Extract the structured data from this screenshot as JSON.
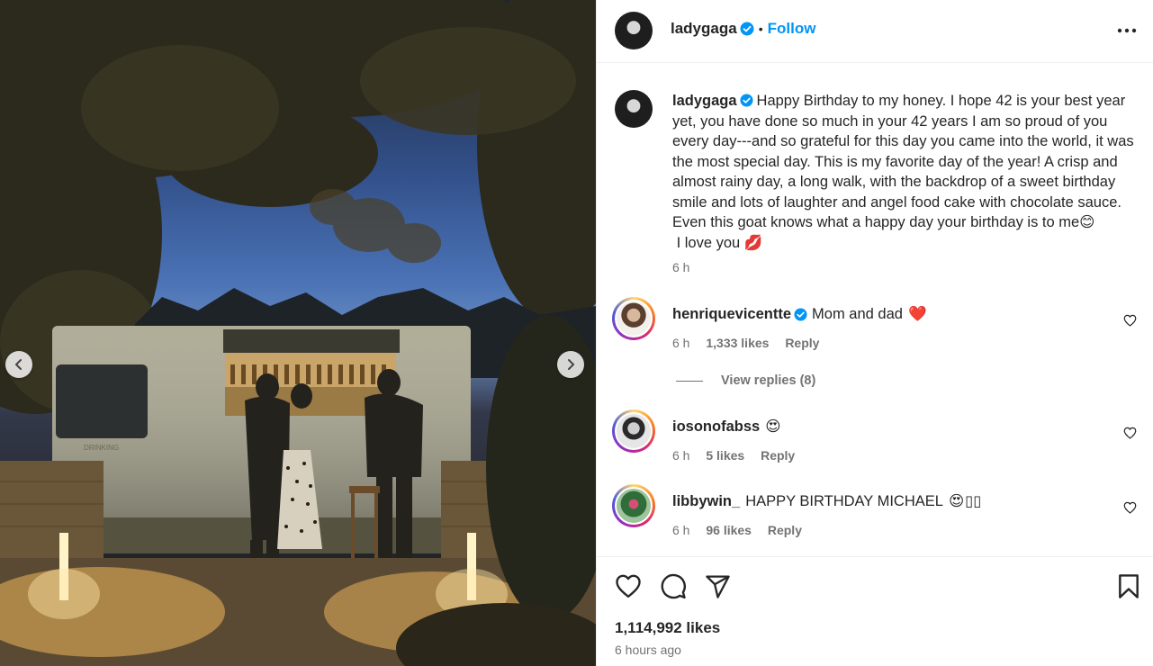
{
  "post": {
    "author": "ladygaga",
    "follow_label": "Follow",
    "separator": "•",
    "caption": "Happy Birthday to my honey. I hope 42 is your best year yet, you have done so much in your 42 years I am so proud of you every day---and so grateful for this day you came into the world, it was the most special day. This is my favorite day of the year! A crisp and almost rainy day, a long walk, with the backdrop of a sweet birthday smile and lots of laughter and angel food cake with chocolate sauce. Even this goat knows what a happy day your birthday is to me",
    "caption_emoji_1": "😊",
    "caption_tail": " I love you ",
    "caption_emoji_2": "💋",
    "caption_time": "6 h",
    "likes": "1,114,992 likes",
    "time_ago": "6 hours ago"
  },
  "photo": {
    "truck_sign": "DRINKING"
  },
  "comments": [
    {
      "username": "henriquevicentte",
      "verified": true,
      "text": "Mom and dad",
      "emoji": "❤️",
      "time": "6 h",
      "likes": "1,333 likes",
      "reply_label": "Reply",
      "view_replies": "View replies (8)"
    },
    {
      "username": "iosonofabss",
      "verified": false,
      "text": "",
      "emoji": "😍",
      "time": "6 h",
      "likes": "5 likes",
      "reply_label": "Reply"
    },
    {
      "username": "libbywin_",
      "verified": false,
      "text": "HAPPY BIRTHDAY MICHAEL",
      "emoji": "😍",
      "extra_glyphs": "▯▯",
      "time": "6 h",
      "likes": "96 likes",
      "reply_label": "Reply"
    }
  ],
  "colors": {
    "accent": "#0095f6",
    "verified": "#0095f6",
    "secondary_text": "#737373",
    "divider": "#efefef"
  },
  "icons": {
    "like": "heart-icon",
    "comment": "comment-icon",
    "share": "share-icon",
    "save": "bookmark-icon",
    "more": "more-options-icon",
    "prev": "chevron-left-icon",
    "next": "chevron-right-icon"
  }
}
